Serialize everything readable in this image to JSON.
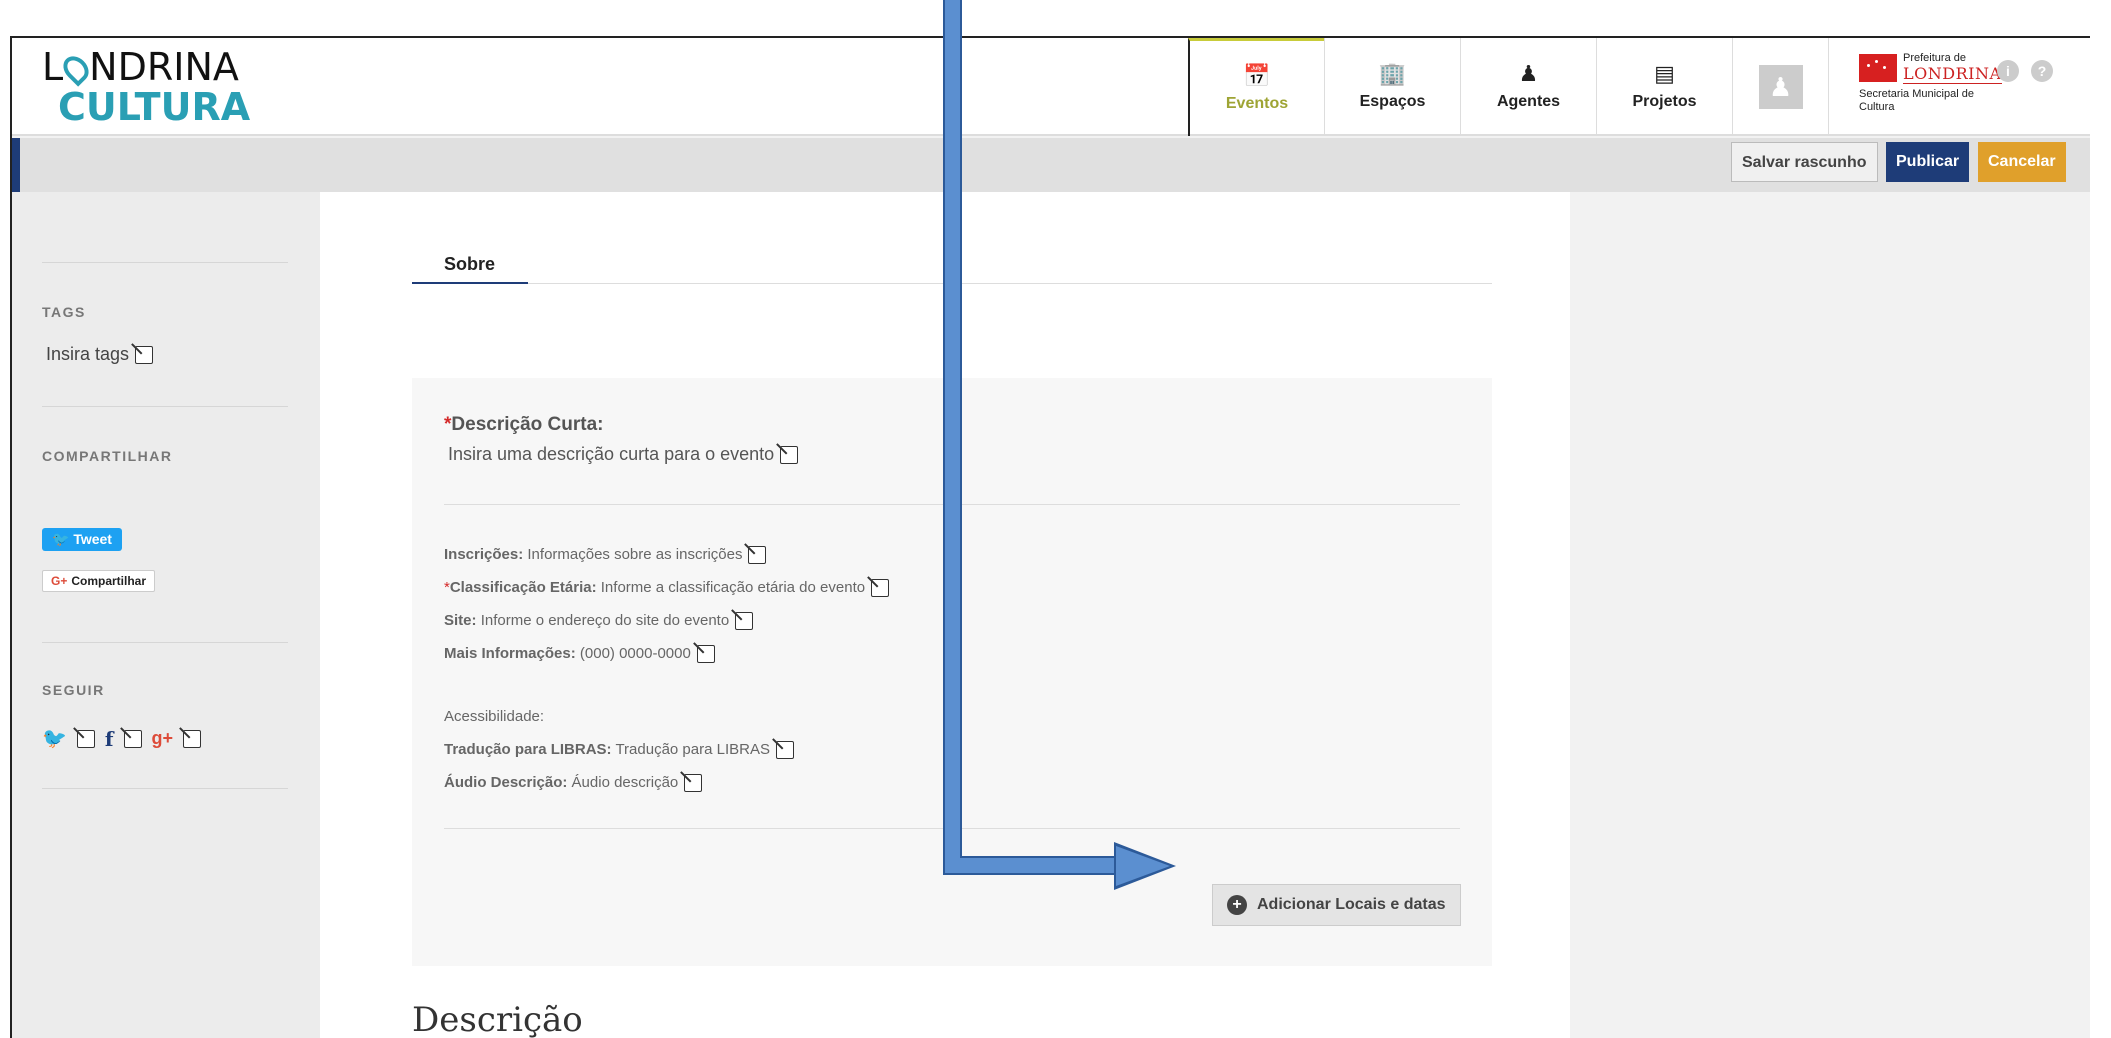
{
  "logo": {
    "line1_a": "L",
    "line1_b": "NDRINA",
    "line2": "CULTURA"
  },
  "nav": [
    {
      "label": "Eventos",
      "icon": "calendar-icon",
      "glyph": "📅"
    },
    {
      "label": "Espaços",
      "icon": "building-icon",
      "glyph": "🏢"
    },
    {
      "label": "Agentes",
      "icon": "person-icon",
      "glyph": "♟"
    },
    {
      "label": "Projetos",
      "icon": "document-icon",
      "glyph": "▤"
    }
  ],
  "prefeitura": {
    "top": "Prefeitura de",
    "city": "LONDRINA",
    "sec": "Secretaria Municipal de Cultura"
  },
  "toolbar": {
    "draft": "Salvar rascunho",
    "publish": "Publicar",
    "cancel": "Cancelar"
  },
  "sidebar": {
    "tags_head": "TAGS",
    "tags_text": "Insira tags",
    "share_head": "COMPARTILHAR",
    "tweet": "Tweet",
    "gplus": "Compartilhar",
    "follow_head": "SEGUIR"
  },
  "main": {
    "tab": "Sobre",
    "desc_short_label": "Descrição Curta:",
    "desc_short_value": "Insira uma descrição curta para o evento",
    "inscricoes_label": "Inscrições:",
    "inscricoes_value": "Informações sobre as inscrições",
    "classif_label": "Classificação Etária:",
    "classif_value": "Informe a classificação etária do evento",
    "site_label": "Site:",
    "site_value": "Informe o endereço do site do evento",
    "mais_label": "Mais Informações:",
    "mais_value": "(000) 0000-0000",
    "acess_label": "Acessibilidade:",
    "libras_label": "Tradução para LIBRAS:",
    "libras_value": "Tradução para LIBRAS",
    "audio_label": "Áudio Descrição:",
    "audio_value": "Áudio descrição",
    "add_button": "Adicionar Locais e datas",
    "descricao_heading": "Descrição"
  },
  "colors": {
    "brand_blue": "#1e3c78",
    "accent_cyan": "#2a9fb4",
    "cancel_orange": "#e0a02b",
    "arrow": "#5b8fd0",
    "active_nav": "#9ea434"
  }
}
